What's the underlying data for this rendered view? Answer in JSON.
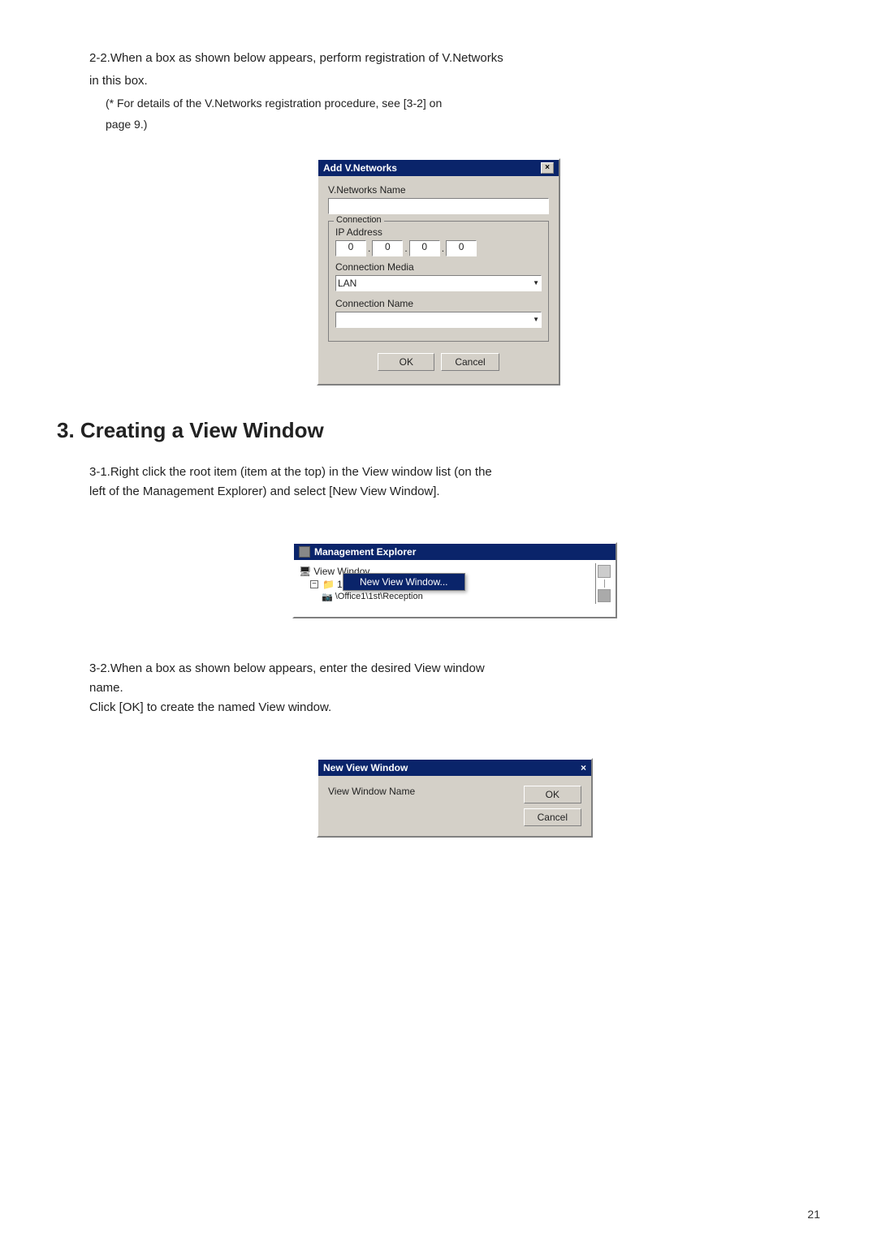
{
  "section22": {
    "line1": "2-2.When a box as shown below appears, perform registration of V.Networks",
    "line2": "in this box.",
    "note": "(* For details of the V.Networks registration procedure, see [3-2] on",
    "note2": "page 9.)"
  },
  "addVNetworksDialog": {
    "title": "Add V.Networks",
    "close": "×",
    "vNetworksNameLabel": "V.Networks Name",
    "connectionLabel": "Connection",
    "ipAddressLabel": "IP Address",
    "ip1": "0",
    "ip2": "0",
    "ip3": "0",
    "ip4": "0",
    "connectionMediaLabel": "Connection Media",
    "connectionMediaValue": "LAN",
    "connectionNameLabel": "Connection Name",
    "okButton": "OK",
    "cancelButton": "Cancel"
  },
  "section3": {
    "title": "3. Creating a View Window",
    "step31line1": "3-1.Right click the root item (item at the top) in the View window list (on the",
    "step31line2": "left of the Management Explorer) and select [New View Window].",
    "step32line1": "3-2.When a box as shown below appears, enter the desired View window",
    "step32line2": "name.",
    "step32line3": "Click [OK] to create the named View window."
  },
  "managementExplorer": {
    "title": "Management Explorer",
    "viewWindowItem": "View Windov",
    "contextMenuLabel": "New View Window...",
    "floor1st": "1st Floor",
    "officeItem": "\\Office1\\1st\\Reception"
  },
  "newViewWindowDialog": {
    "title": "New View Window",
    "close": "×",
    "viewWindowNameLabel": "View Window Name",
    "okButton": "OK",
    "cancelButton": "Cancel"
  },
  "pageNumber": "21"
}
